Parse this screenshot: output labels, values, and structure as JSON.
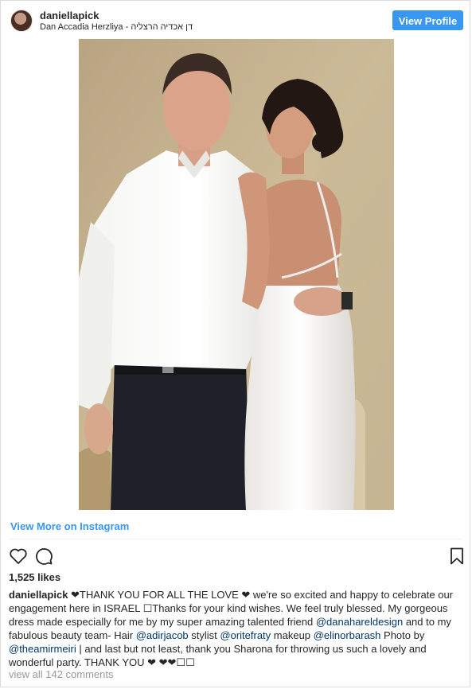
{
  "header": {
    "username": "daniellapick",
    "location": "Dan Accadia Herzliya - דן אכדיה הרצליה",
    "view_profile_label": "View Profile"
  },
  "post": {
    "view_more_label": "View More on Instagram",
    "likes": "1,525 likes",
    "caption": {
      "author": "daniellapick",
      "parts": [
        {
          "type": "text",
          "value": " ❤THANK YOU FOR ALL THE LOVE ❤ we're so excited and happy to celebrate our engagement here in ISRAEL ☐Thanks for your kind wishes. We feel truly blessed. My gorgeous dress made especially for me by my super amazing talented friend "
        },
        {
          "type": "mention",
          "value": "@danahareldesign"
        },
        {
          "type": "text",
          "value": " and to my fabulous beauty team- Hair "
        },
        {
          "type": "mention",
          "value": "@adirjacob"
        },
        {
          "type": "text",
          "value": " stylist "
        },
        {
          "type": "mention",
          "value": "@oritefraty"
        },
        {
          "type": "text",
          "value": " makeup "
        },
        {
          "type": "mention",
          "value": "@elinorbarash"
        },
        {
          "type": "text",
          "value": " Photo by "
        },
        {
          "type": "mention",
          "value": "@theamirmeiri"
        },
        {
          "type": "text",
          "value": " | and last but not least, thank you Sharona for throwing us such a lovely and wonderful party. THANK YOU ❤ ❤❤☐☐"
        }
      ]
    },
    "comments_label": "view all 142 comments"
  },
  "icons": {
    "like": "heart-outline-icon",
    "comment": "speech-bubble-icon",
    "save": "bookmark-icon"
  },
  "colors": {
    "accent": "#3897f0",
    "mention": "#003569",
    "muted": "#999999"
  }
}
